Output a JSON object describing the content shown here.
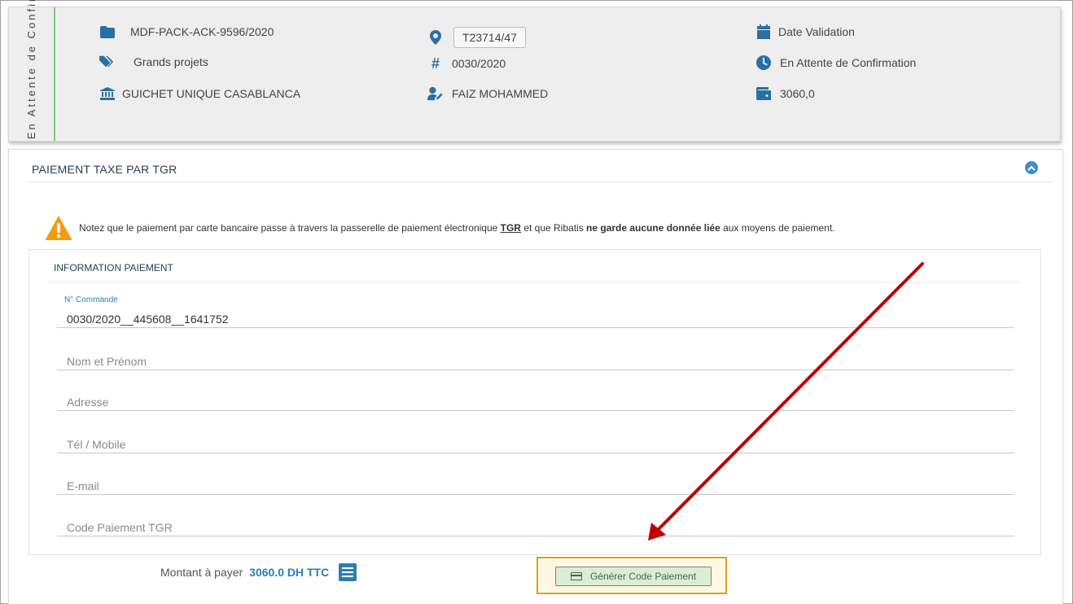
{
  "header": {
    "status_label": "En Attente de Confirmation",
    "reference": "MDF-PACK-ACK-9596/2020",
    "category": "Grands projets",
    "guichet": "GUICHET UNIQUE CASABLANCA",
    "location_code": "T23714/47",
    "number": "0030/2020",
    "person": "FAIZ MOHAMMED",
    "date_label": "Date Validation",
    "state": "En Attente de Confirmation",
    "amount": "3060,0"
  },
  "panel": {
    "title": "PAIEMENT TAXE PAR TGR",
    "notice": {
      "part1": "Notez que le paiement par carte bancaire passe à travers la passerelle de paiement électronique ",
      "tgr": "TGR",
      "part2": " et que Ribatis ",
      "bold": "ne garde aucune donnée liée",
      "part3": " aux moyens de paiement."
    },
    "info_title": "INFORMATION PAIEMENT",
    "fields": {
      "commande_label": "N° Commande",
      "commande_value": "0030/2020__445608__1641752",
      "nom_placeholder": "Nom et Prénom",
      "adresse_placeholder": "Adresse",
      "tel_placeholder": "Tél / Mobile",
      "email_placeholder": "E-mail",
      "code_placeholder": "Code Paiement TGR"
    },
    "amount_label": "Montant à payer",
    "amount_value": "3060.0 DH TTC",
    "generate_button": "Générer Code Paiement"
  },
  "colors": {
    "accent": "#2a7fb8",
    "status_border": "#7ccd7c",
    "highlight_border": "#d4a71c",
    "arrow": "#c00000",
    "warning": "#f39c12"
  }
}
